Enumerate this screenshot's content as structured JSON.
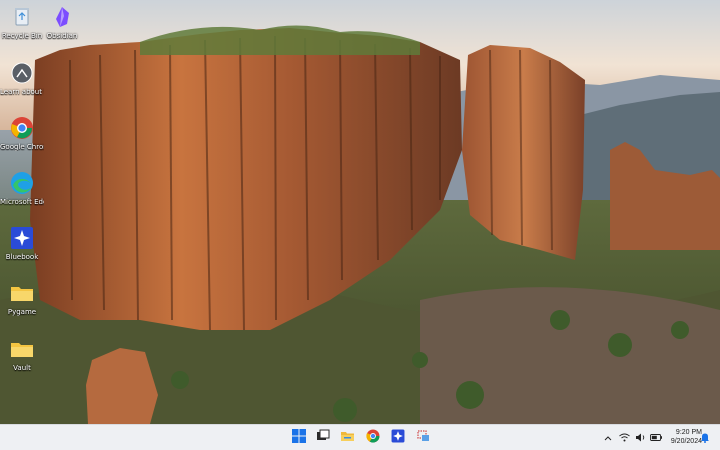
{
  "desktop": {
    "icons": [
      {
        "label": "Recycle Bin",
        "icon": "recycle-bin-icon"
      },
      {
        "label": "Obsidian",
        "icon": "obsidian-icon"
      },
      {
        "label": "Learn about this picture",
        "icon": "learn-about-picture-icon"
      },
      {
        "label": "Google Chrome",
        "icon": "chrome-icon"
      },
      {
        "label": "Microsoft Edge",
        "icon": "edge-icon"
      },
      {
        "label": "Bluebook",
        "icon": "bluebook-icon"
      },
      {
        "label": "Pygame",
        "icon": "folder-icon"
      },
      {
        "label": "Vault",
        "icon": "folder-icon"
      }
    ]
  },
  "taskbar": {
    "pinned": [
      {
        "name": "start",
        "icon": "windows-start-icon"
      },
      {
        "name": "task-view",
        "icon": "task-view-icon"
      },
      {
        "name": "file-explorer",
        "icon": "file-explorer-icon"
      },
      {
        "name": "chrome",
        "icon": "chrome-icon"
      },
      {
        "name": "bluebook",
        "icon": "bluebook-icon"
      },
      {
        "name": "snipping",
        "icon": "snipping-tool-icon"
      }
    ],
    "tray": {
      "icons": [
        "chevron-up-icon",
        "wifi-icon",
        "volume-icon",
        "battery-icon"
      ],
      "time": "9:20 PM",
      "date": "9/20/2024",
      "notification_icon": "notification-bell-icon"
    }
  },
  "colors": {
    "taskbar_bg": "#eef0f3",
    "windows_blue": "#1a73e8",
    "folder_yellow": "#f4c542"
  }
}
